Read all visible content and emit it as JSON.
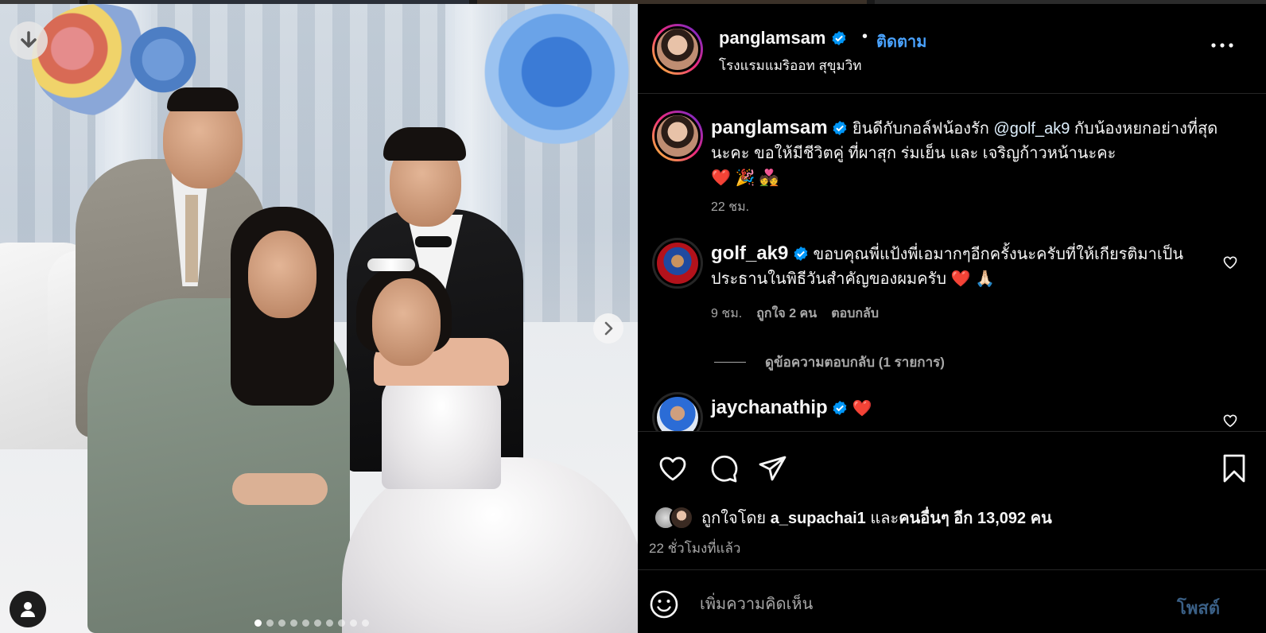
{
  "post": {
    "header": {
      "username": "panglamsam",
      "separator": "•",
      "follow_label": "ติดตาม",
      "location": "โรงแรมแมริออท สุขุมวิท"
    },
    "caption": {
      "username": "panglamsam",
      "text_before": "ยินดีกับกอล์ฟน้องรัก ",
      "mention": "@golf_ak9",
      "text_after": " กับน้องหยกอย่างที่สุดนะคะ ขอให้มีชีวิตคู่ ที่ผาสุก ร่มเย็น และ เจริญก้าวหน้านะคะ",
      "emojis": "❤️ 🎉 💑",
      "time": "22 ชม."
    },
    "comments": [
      {
        "username": "golf_ak9",
        "text": "ขอบคุณพี่แป้งพี่เอมากๆอีกครั้งนะครับที่ให้เกียรติมาเป็นประธานในพิธีวันสำคัญของผมครับ",
        "emojis": "❤️ 🙏🏻",
        "time": "9 ชม.",
        "likes_label": "ถูกใจ 2 คน",
        "reply_label": "ตอบกลับ",
        "view_replies_label": "ดูข้อความตอบกลับ (1 รายการ)"
      },
      {
        "username": "jaychanathip",
        "text": "",
        "emojis": "❤️"
      }
    ],
    "likes": {
      "prefix": "ถูกใจโดย",
      "user": "a_supachai1",
      "joiner": "และ",
      "others": "คนอื่นๆ อีก 13,092 คน"
    },
    "posted_time": "22 ชั่วโมงที่แล้ว",
    "composer": {
      "placeholder": "เพิ่มความคิดเห็น",
      "post_label": "โพสต์"
    },
    "carousel": {
      "total_slides": 10,
      "active_slide": 1
    },
    "icons": {
      "download": "arrow-down-icon",
      "next": "chevron-right-icon",
      "tagged_user": "user-icon",
      "more": "more-horizontal-icon",
      "verified": "verified-badge-icon",
      "like": "heart-icon",
      "comment": "comment-icon",
      "share": "send-icon",
      "save": "bookmark-icon",
      "emoji": "smiley-icon"
    },
    "colors": {
      "accent_blue": "#4aa3ff",
      "verified_blue": "#0095f6",
      "muted_text": "#a8a8a8",
      "post_button_disabled": "#3a5f85"
    }
  }
}
